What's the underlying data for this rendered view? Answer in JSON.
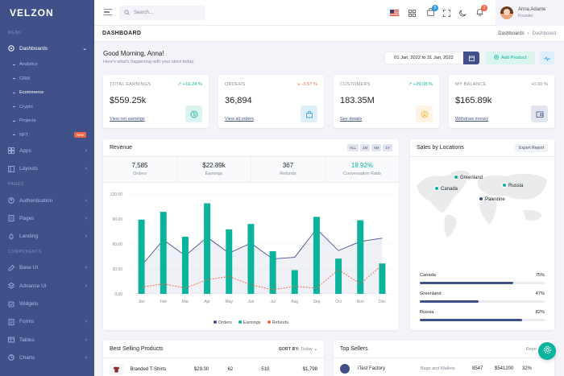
{
  "brand": "VELZON",
  "sidebar": {
    "section_menu": "MENU",
    "section_pages": "PAGES",
    "section_components": "COMPONENTS",
    "dashboards": "Dashboards",
    "sub": [
      "Analytics",
      "CRM",
      "Ecommerce",
      "Crypto",
      "Projects",
      "NFT"
    ],
    "nft_badge": "New",
    "apps": "Apps",
    "layouts": "Layouts",
    "authentication": "Authentication",
    "pages": "Pages",
    "landing": "Landing",
    "base_ui": "Base UI",
    "advance_ui": "Advance UI",
    "widgets": "Widgets",
    "forms": "Forms",
    "tables": "Tables",
    "charts": "Charts"
  },
  "topbar": {
    "search_placeholder": "Search...",
    "cart_badge": "5",
    "notif_badge": "3",
    "user_name": "Anna Adame",
    "user_role": "Founder"
  },
  "page": {
    "title": "DASHBOARD",
    "breadcrumb_parent": "Dashboards",
    "breadcrumb_current": "Dashboard",
    "greeting": "Good Morning, Anna!",
    "subgreeting": "Here's what's happening with your store today.",
    "date_range": "01 Jan, 2022 to 31 Jan, 2022",
    "add_product": "Add Product"
  },
  "kpis": [
    {
      "label": "TOTAL EARNINGS",
      "change": "+16.24 %",
      "dir": "up",
      "value": "$559.25k",
      "link": "View net earnings",
      "icon": "dollar-icon",
      "bg": "#daf4f0",
      "fg": "#0ab39c"
    },
    {
      "label": "ORDERS",
      "change": "-3.57 %",
      "dir": "down",
      "value": "36,894",
      "link": "View all orders",
      "icon": "shopping-bag-icon",
      "bg": "#dff0fa",
      "fg": "#299cdb"
    },
    {
      "label": "CUSTOMERS",
      "change": "+29.08 %",
      "dir": "up",
      "value": "183.35M",
      "link": "See details",
      "icon": "user-circle-icon",
      "bg": "#fef4e4",
      "fg": "#f7b84b"
    },
    {
      "label": "MY BALANCE",
      "change": "+0.00 %",
      "dir": "flat",
      "value": "$165.89k",
      "link": "Withdraw money",
      "icon": "wallet-icon",
      "bg": "#e2e5ed",
      "fg": "#405189"
    }
  ],
  "revenue": {
    "title": "Revenue",
    "buttons": [
      "ALL",
      "1M",
      "6M",
      "1Y"
    ],
    "stats": [
      {
        "value": "7,585",
        "label": "Orders"
      },
      {
        "value": "$22.89k",
        "label": "Earnings"
      },
      {
        "value": "367",
        "label": "Refunds"
      },
      {
        "value": "18.92%",
        "label": "Conversation Ratio"
      }
    ],
    "legend": [
      "Orders",
      "Earnings",
      "Refunds"
    ]
  },
  "chart_data": {
    "type": "bar",
    "categories": [
      "Jan",
      "Feb",
      "Mar",
      "Apr",
      "May",
      "Jun",
      "Jul",
      "Aug",
      "Sep",
      "Oct",
      "Nov",
      "Dec"
    ],
    "yticks": [
      "0.00",
      "30.00",
      "60.00",
      "90.00",
      "120.00"
    ],
    "ylim": [
      0,
      120
    ],
    "series": [
      {
        "name": "Orders",
        "type": "area",
        "color": "#405189",
        "values": [
          34,
          65,
          46,
          68,
          49,
          61,
          42,
          44,
          78,
          52,
          63,
          67
        ]
      },
      {
        "name": "Earnings",
        "type": "bar",
        "color": "#0ab39c",
        "values": [
          89.25,
          98.58,
          68.74,
          108.87,
          77.54,
          84.03,
          51.24,
          28.57,
          92.57,
          42.36,
          88.51,
          36.57
        ]
      },
      {
        "name": "Refunds",
        "type": "line",
        "color": "#f06548",
        "values": [
          8,
          12,
          7,
          17,
          21,
          11,
          5,
          9,
          7,
          29,
          12,
          35
        ]
      }
    ]
  },
  "locations": {
    "title": "Sales by Locations",
    "export": "Export Report",
    "markers": [
      "Greenland",
      "Canada",
      "Russia",
      "Palestine"
    ],
    "rows": [
      {
        "name": "Canada",
        "pct": "75%",
        "value": 75
      },
      {
        "name": "Greenland",
        "pct": "47%",
        "value": 47
      },
      {
        "name": "Russia",
        "pct": "82%",
        "value": 82
      }
    ]
  },
  "best_selling": {
    "title": "Best Selling Products",
    "sort_label": "SORT BY:",
    "sort_value": "Today",
    "row": {
      "name": "Branded T-Shirts",
      "price": "$29.00",
      "orders": "62",
      "stock": "510",
      "amount": "$1,798"
    }
  },
  "top_sellers": {
    "title": "Top Sellers",
    "report": "Repo",
    "row": {
      "name": "iTest Factory",
      "category": "Bags and Wallets",
      "stock": "8547",
      "amount": "$541200",
      "pct": "32%"
    }
  }
}
